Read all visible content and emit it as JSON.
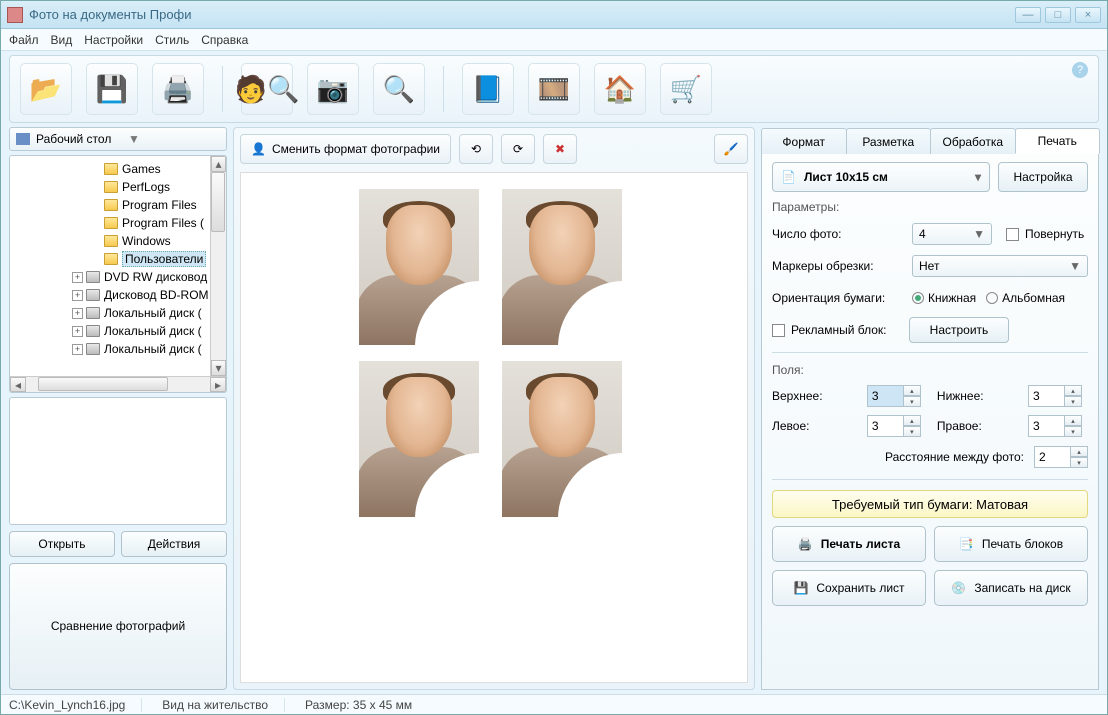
{
  "window": {
    "title": "Фото на документы Профи"
  },
  "menu": [
    "Файл",
    "Вид",
    "Настройки",
    "Стиль",
    "Справка"
  ],
  "left": {
    "combo": "Рабочий стол",
    "tree": [
      {
        "indent": 80,
        "icon": "folder",
        "exp": "",
        "label": "Games"
      },
      {
        "indent": 80,
        "icon": "folder",
        "exp": "",
        "label": "PerfLogs"
      },
      {
        "indent": 80,
        "icon": "folder",
        "exp": "",
        "label": "Program Files"
      },
      {
        "indent": 80,
        "icon": "folder",
        "exp": "",
        "label": "Program Files ("
      },
      {
        "indent": 80,
        "icon": "folder",
        "exp": "",
        "label": "Windows"
      },
      {
        "indent": 80,
        "icon": "folder",
        "exp": "",
        "label": "Пользователи",
        "sel": true
      },
      {
        "indent": 62,
        "icon": "drive",
        "exp": "+",
        "label": "DVD RW дисковод"
      },
      {
        "indent": 62,
        "icon": "drive",
        "exp": "+",
        "label": "Дисковод BD-ROM"
      },
      {
        "indent": 62,
        "icon": "drive",
        "exp": "+",
        "label": "Локальный диск ("
      },
      {
        "indent": 62,
        "icon": "drive",
        "exp": "+",
        "label": "Локальный диск ("
      },
      {
        "indent": 62,
        "icon": "drive",
        "exp": "+",
        "label": "Локальный диск ("
      }
    ],
    "open": "Открыть",
    "actions": "Действия",
    "compare": "Сравнение фотографий"
  },
  "center": {
    "changeFormat": "Сменить формат фотографии"
  },
  "right": {
    "tabs": [
      "Формат",
      "Разметка",
      "Обработка",
      "Печать"
    ],
    "activeTab": 3,
    "page": "Лист 10x15 см",
    "configure": "Настройка",
    "params": "Параметры:",
    "countLabel": "Число фото:",
    "countValue": "4",
    "rotate": "Повернуть",
    "markersLabel": "Маркеры обрезки:",
    "markersValue": "Нет",
    "orientLabel": "Ориентация бумаги:",
    "orientPortrait": "Книжная",
    "orientLandscape": "Альбомная",
    "adblock": "Рекламный блок:",
    "adconfigure": "Настроить",
    "margins": "Поля:",
    "top": "Верхнее:",
    "topV": "3",
    "bottom": "Нижнее:",
    "bottomV": "3",
    "leftM": "Левое:",
    "leftV": "3",
    "rightM": "Правое:",
    "rightV": "3",
    "gap": "Расстояние между фото:",
    "gapV": "2",
    "paper": "Требуемый тип бумаги: Матовая",
    "printSheet": "Печать листа",
    "printBlocks": "Печать блоков",
    "saveSheet": "Сохранить лист",
    "burn": "Записать на диск"
  },
  "status": {
    "file": "C:\\Kevin_Lynch16.jpg",
    "type": "Вид на жительство",
    "size": "Размер: 35 x 45 мм"
  }
}
